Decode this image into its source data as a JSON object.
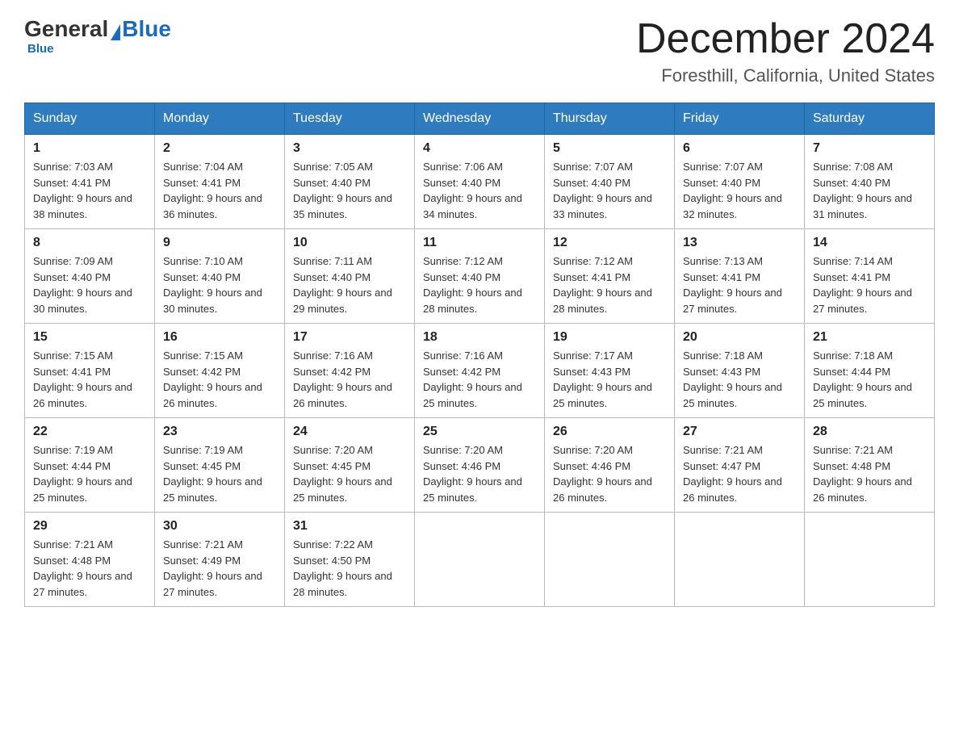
{
  "header": {
    "logo": {
      "general": "General",
      "blue": "Blue",
      "sub": "Blue"
    },
    "title": "December 2024",
    "subtitle": "Foresthill, California, United States"
  },
  "days_of_week": [
    "Sunday",
    "Monday",
    "Tuesday",
    "Wednesday",
    "Thursday",
    "Friday",
    "Saturday"
  ],
  "weeks": [
    [
      {
        "day": "1",
        "sunrise": "Sunrise: 7:03 AM",
        "sunset": "Sunset: 4:41 PM",
        "daylight": "Daylight: 9 hours and 38 minutes."
      },
      {
        "day": "2",
        "sunrise": "Sunrise: 7:04 AM",
        "sunset": "Sunset: 4:41 PM",
        "daylight": "Daylight: 9 hours and 36 minutes."
      },
      {
        "day": "3",
        "sunrise": "Sunrise: 7:05 AM",
        "sunset": "Sunset: 4:40 PM",
        "daylight": "Daylight: 9 hours and 35 minutes."
      },
      {
        "day": "4",
        "sunrise": "Sunrise: 7:06 AM",
        "sunset": "Sunset: 4:40 PM",
        "daylight": "Daylight: 9 hours and 34 minutes."
      },
      {
        "day": "5",
        "sunrise": "Sunrise: 7:07 AM",
        "sunset": "Sunset: 4:40 PM",
        "daylight": "Daylight: 9 hours and 33 minutes."
      },
      {
        "day": "6",
        "sunrise": "Sunrise: 7:07 AM",
        "sunset": "Sunset: 4:40 PM",
        "daylight": "Daylight: 9 hours and 32 minutes."
      },
      {
        "day": "7",
        "sunrise": "Sunrise: 7:08 AM",
        "sunset": "Sunset: 4:40 PM",
        "daylight": "Daylight: 9 hours and 31 minutes."
      }
    ],
    [
      {
        "day": "8",
        "sunrise": "Sunrise: 7:09 AM",
        "sunset": "Sunset: 4:40 PM",
        "daylight": "Daylight: 9 hours and 30 minutes."
      },
      {
        "day": "9",
        "sunrise": "Sunrise: 7:10 AM",
        "sunset": "Sunset: 4:40 PM",
        "daylight": "Daylight: 9 hours and 30 minutes."
      },
      {
        "day": "10",
        "sunrise": "Sunrise: 7:11 AM",
        "sunset": "Sunset: 4:40 PM",
        "daylight": "Daylight: 9 hours and 29 minutes."
      },
      {
        "day": "11",
        "sunrise": "Sunrise: 7:12 AM",
        "sunset": "Sunset: 4:40 PM",
        "daylight": "Daylight: 9 hours and 28 minutes."
      },
      {
        "day": "12",
        "sunrise": "Sunrise: 7:12 AM",
        "sunset": "Sunset: 4:41 PM",
        "daylight": "Daylight: 9 hours and 28 minutes."
      },
      {
        "day": "13",
        "sunrise": "Sunrise: 7:13 AM",
        "sunset": "Sunset: 4:41 PM",
        "daylight": "Daylight: 9 hours and 27 minutes."
      },
      {
        "day": "14",
        "sunrise": "Sunrise: 7:14 AM",
        "sunset": "Sunset: 4:41 PM",
        "daylight": "Daylight: 9 hours and 27 minutes."
      }
    ],
    [
      {
        "day": "15",
        "sunrise": "Sunrise: 7:15 AM",
        "sunset": "Sunset: 4:41 PM",
        "daylight": "Daylight: 9 hours and 26 minutes."
      },
      {
        "day": "16",
        "sunrise": "Sunrise: 7:15 AM",
        "sunset": "Sunset: 4:42 PM",
        "daylight": "Daylight: 9 hours and 26 minutes."
      },
      {
        "day": "17",
        "sunrise": "Sunrise: 7:16 AM",
        "sunset": "Sunset: 4:42 PM",
        "daylight": "Daylight: 9 hours and 26 minutes."
      },
      {
        "day": "18",
        "sunrise": "Sunrise: 7:16 AM",
        "sunset": "Sunset: 4:42 PM",
        "daylight": "Daylight: 9 hours and 25 minutes."
      },
      {
        "day": "19",
        "sunrise": "Sunrise: 7:17 AM",
        "sunset": "Sunset: 4:43 PM",
        "daylight": "Daylight: 9 hours and 25 minutes."
      },
      {
        "day": "20",
        "sunrise": "Sunrise: 7:18 AM",
        "sunset": "Sunset: 4:43 PM",
        "daylight": "Daylight: 9 hours and 25 minutes."
      },
      {
        "day": "21",
        "sunrise": "Sunrise: 7:18 AM",
        "sunset": "Sunset: 4:44 PM",
        "daylight": "Daylight: 9 hours and 25 minutes."
      }
    ],
    [
      {
        "day": "22",
        "sunrise": "Sunrise: 7:19 AM",
        "sunset": "Sunset: 4:44 PM",
        "daylight": "Daylight: 9 hours and 25 minutes."
      },
      {
        "day": "23",
        "sunrise": "Sunrise: 7:19 AM",
        "sunset": "Sunset: 4:45 PM",
        "daylight": "Daylight: 9 hours and 25 minutes."
      },
      {
        "day": "24",
        "sunrise": "Sunrise: 7:20 AM",
        "sunset": "Sunset: 4:45 PM",
        "daylight": "Daylight: 9 hours and 25 minutes."
      },
      {
        "day": "25",
        "sunrise": "Sunrise: 7:20 AM",
        "sunset": "Sunset: 4:46 PM",
        "daylight": "Daylight: 9 hours and 25 minutes."
      },
      {
        "day": "26",
        "sunrise": "Sunrise: 7:20 AM",
        "sunset": "Sunset: 4:46 PM",
        "daylight": "Daylight: 9 hours and 26 minutes."
      },
      {
        "day": "27",
        "sunrise": "Sunrise: 7:21 AM",
        "sunset": "Sunset: 4:47 PM",
        "daylight": "Daylight: 9 hours and 26 minutes."
      },
      {
        "day": "28",
        "sunrise": "Sunrise: 7:21 AM",
        "sunset": "Sunset: 4:48 PM",
        "daylight": "Daylight: 9 hours and 26 minutes."
      }
    ],
    [
      {
        "day": "29",
        "sunrise": "Sunrise: 7:21 AM",
        "sunset": "Sunset: 4:48 PM",
        "daylight": "Daylight: 9 hours and 27 minutes."
      },
      {
        "day": "30",
        "sunrise": "Sunrise: 7:21 AM",
        "sunset": "Sunset: 4:49 PM",
        "daylight": "Daylight: 9 hours and 27 minutes."
      },
      {
        "day": "31",
        "sunrise": "Sunrise: 7:22 AM",
        "sunset": "Sunset: 4:50 PM",
        "daylight": "Daylight: 9 hours and 28 minutes."
      },
      null,
      null,
      null,
      null
    ]
  ]
}
